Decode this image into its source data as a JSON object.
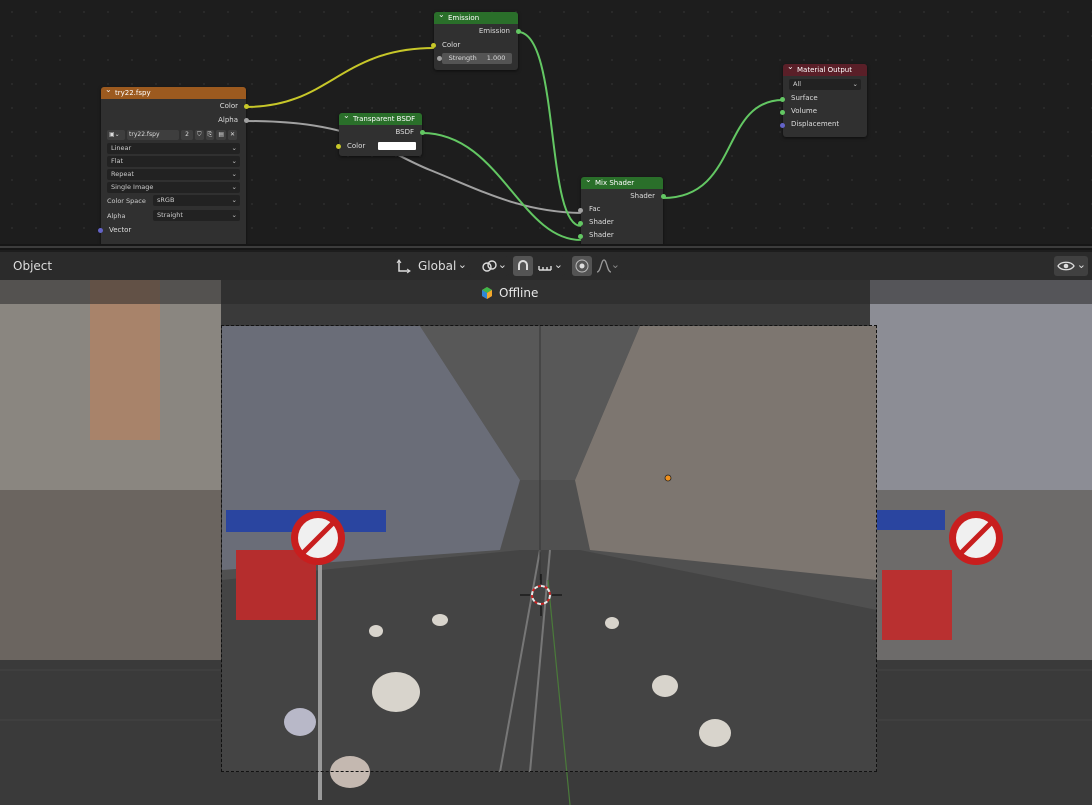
{
  "node_editor": {
    "nodes": {
      "image_texture": {
        "title": "try22.fspy",
        "outputs": [
          "Color",
          "Alpha"
        ],
        "image_name": "try22.fspy",
        "users": "2",
        "interpolation": "Linear",
        "projection": "Flat",
        "extension": "Repeat",
        "source": "Single Image",
        "color_space_label": "Color Space",
        "color_space": "sRGB",
        "alpha_label": "Alpha",
        "alpha_mode": "Straight",
        "vector_input": "Vector"
      },
      "emission": {
        "title": "Emission",
        "output": "Emission",
        "color_input": "Color",
        "strength_label": "Strength",
        "strength_value": "1.000"
      },
      "transparent_bsdf": {
        "title": "Transparent BSDF",
        "output": "BSDF",
        "color_input": "Color",
        "color_value": "#ffffff"
      },
      "mix_shader": {
        "title": "Mix Shader",
        "output": "Shader",
        "inputs": [
          "Fac",
          "Shader",
          "Shader"
        ]
      },
      "material_output": {
        "title": "Material Output",
        "target": "All",
        "inputs": [
          "Surface",
          "Volume",
          "Displacement"
        ]
      }
    },
    "colors": {
      "shader_header": "#2a6f2a",
      "texture_header": "#9c5a1f",
      "output_header": "#5a1f28",
      "color_socket": "#c7c729",
      "float_socket": "#a1a1a1",
      "shader_socket": "#63c763",
      "vector_socket": "#6363c7"
    }
  },
  "viewport_header": {
    "mode": "Object",
    "transform_orientation": "Global",
    "icons": [
      "transform-gizmo-icon",
      "pivot-icon",
      "snap-magnet-icon",
      "snap-increment-icon",
      "proportional-edit-icon",
      "falloff-icon",
      "visibility-icon"
    ]
  },
  "viewport": {
    "render_status": "Offline"
  }
}
